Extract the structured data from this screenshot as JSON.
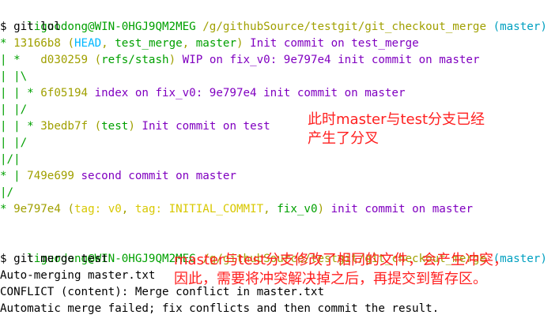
{
  "colors": {
    "graph": "#00a000",
    "hash": "#a0a000",
    "ref_paren": "#a0a000",
    "head": "#00b7ff",
    "branch": "#00a000",
    "tag": "#d8c800",
    "message": "#8000c0",
    "user": "#00a000",
    "path": "#a0a000",
    "prompt": "#000000",
    "annotation": "#ff2020",
    "conflict": "#000000"
  },
  "block1": {
    "user": "liguodong@WIN-0HGJ9QM2MEG",
    "path": "/g/githubSource/testgit/git_checkout_merge",
    "branch": "(master)",
    "command": "$ git lol"
  },
  "log": [
    {
      "graph": "* ",
      "hash": "13166b8",
      "refs": [
        {
          "text": "HEAD",
          "kind": "head"
        },
        {
          "text": "test_merge",
          "kind": "branch"
        },
        {
          "text": "master",
          "kind": "branch"
        }
      ],
      "msg": "Init commit on test_merge"
    },
    {
      "graph": "| *   ",
      "hash": "d030259",
      "refs": [
        {
          "text": "refs/stash",
          "kind": "branch"
        }
      ],
      "msg": "WIP on fix_v0: 9e797e4 init commit on master"
    },
    {
      "graph": "| |\\",
      "hash": "",
      "refs": [],
      "msg": ""
    },
    {
      "graph": "| | * ",
      "hash": "6f05194",
      "refs": [],
      "msg": "index on fix_v0: 9e797e4 init commit on master"
    },
    {
      "graph": "| |/",
      "hash": "",
      "refs": [],
      "msg": ""
    },
    {
      "graph": "| | * ",
      "hash": "3bedb7f",
      "refs": [
        {
          "text": "test",
          "kind": "branch"
        }
      ],
      "msg": "Init commit on test"
    },
    {
      "graph": "| |/",
      "hash": "",
      "refs": [],
      "msg": ""
    },
    {
      "graph": "|/|",
      "hash": "",
      "refs": [],
      "msg": ""
    },
    {
      "graph": "* | ",
      "hash": "749e699",
      "refs": [],
      "msg": "second commit on master"
    },
    {
      "graph": "|/",
      "hash": "",
      "refs": [],
      "msg": ""
    },
    {
      "graph": "* ",
      "hash": "9e797e4",
      "refs": [
        {
          "text": "tag: v0",
          "kind": "tag"
        },
        {
          "text": "tag: INITIAL_COMMIT",
          "kind": "tag"
        },
        {
          "text": "fix_v0",
          "kind": "branch"
        }
      ],
      "msg": "init commit on master"
    }
  ],
  "block2": {
    "user": "liguodong@WIN-0HGJ9QM2MEG",
    "path": "/g/githubSource/testgit/git_checkout_merge",
    "branch": "(master)",
    "command": "$ git merge test",
    "output": [
      "Auto-merging master.txt",
      "CONFLICT (content): Merge conflict in master.txt",
      "Automatic merge failed; fix conflicts and then commit the result."
    ]
  },
  "annotations": {
    "first_line1": "此时master与test分支已经",
    "first_line2": "产生了分叉",
    "second_line1": "master与test分支修改了相同的文件，会产生冲突，",
    "second_line2": "因此，需要将冲突解决掉之后，再提交到暂存区。"
  }
}
